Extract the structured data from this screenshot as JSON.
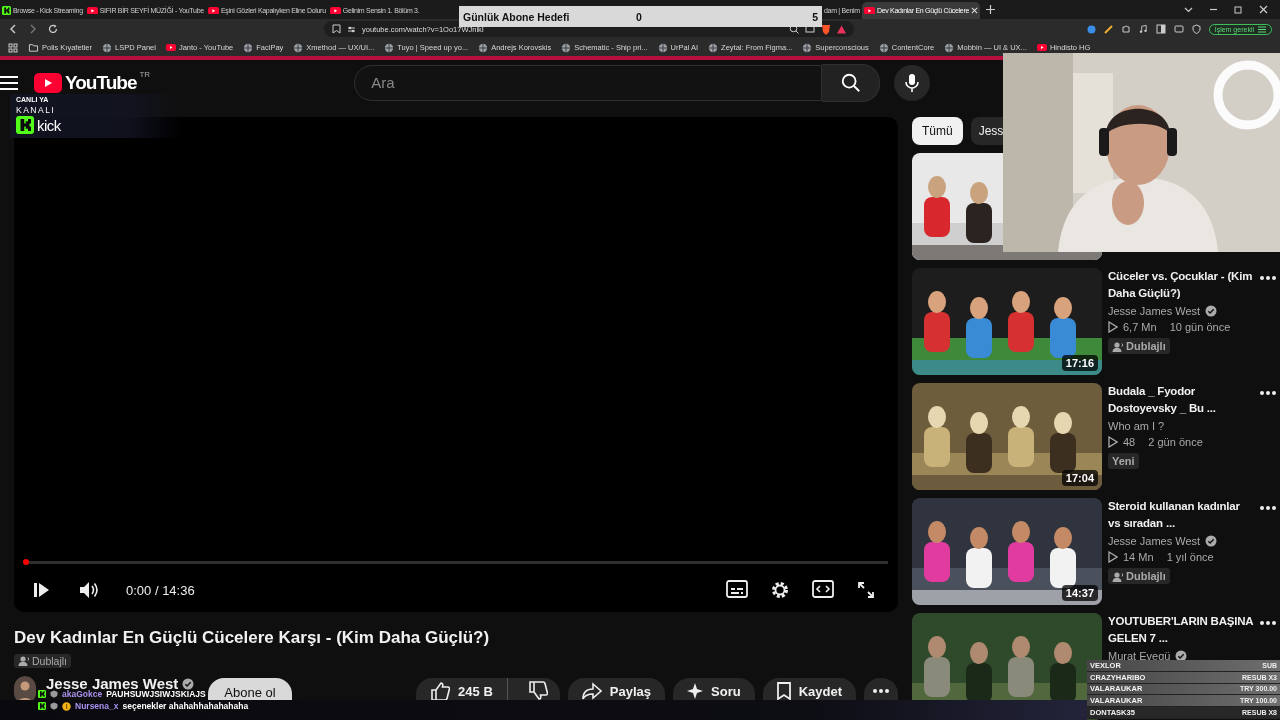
{
  "browser": {
    "tabs": [
      {
        "kind": "kick",
        "title": "Browse - Kick Streaming",
        "selected": false
      },
      {
        "kind": "youtube",
        "title": "SIFIR BİR SEYFİ MÜZİĞİ - YouTube",
        "selected": false
      },
      {
        "kind": "youtube",
        "title": "Eşini Gözleri Kapalıyken Eline Doluru",
        "selected": false
      },
      {
        "kind": "youtube",
        "title": "Gelinim Sensin 1. Bölüm 3.",
        "selected": false
      },
      {
        "kind": "plain",
        "title": "dam | Benim",
        "selected": false
      },
      {
        "kind": "youtube",
        "title": "Dev Kadınlar En Güçlü Cücelere",
        "selected": true
      }
    ],
    "address": "youtube.com/watch?v=1Oo17WJnikI",
    "bookmarks": [
      {
        "kind": "folder",
        "label": "Polis Kıyafetler"
      },
      {
        "kind": "site",
        "label": "LSPD Panel"
      },
      {
        "kind": "youtube",
        "label": "Janto - YouTube"
      },
      {
        "kind": "site",
        "label": "FaciPay"
      },
      {
        "kind": "site",
        "label": "Xmethod — UX/UI..."
      },
      {
        "kind": "site",
        "label": "Tuyo | Speed up yo..."
      },
      {
        "kind": "site",
        "label": "Andrejs Korovskis"
      },
      {
        "kind": "site",
        "label": "Schematic - Ship pri..."
      },
      {
        "kind": "site",
        "label": "UrPal AI"
      },
      {
        "kind": "site",
        "label": "Zeytal: From Figma..."
      },
      {
        "kind": "site",
        "label": "Superconscious"
      },
      {
        "kind": "site",
        "label": "ContentCore"
      },
      {
        "kind": "site",
        "label": "Mobbin — UI & UX..."
      },
      {
        "kind": "youtube",
        "label": "Hindisto HG"
      }
    ],
    "action_button": "İşlem gerekli"
  },
  "youtube": {
    "logo": "YouTube",
    "region": "TR",
    "search": {
      "placeholder": "Ara"
    },
    "player": {
      "time": "0:00 / 14:36",
      "level": 0
    },
    "video": {
      "title": "Dev Kadınlar En Güçlü Cücelere Karşı - (Kim Daha Güçlü?)",
      "badge": "Dublajlı",
      "channel": "Jesse James West",
      "verified": true,
      "subscribe": "Abone ol",
      "likes": "245 B",
      "share": "Paylaş",
      "ask": "Soru",
      "save": "Kaydet"
    },
    "chips": [
      {
        "label": "Tümü",
        "selected": true
      },
      {
        "label": "Jess",
        "selected": false
      }
    ],
    "recommendations": [
      {
        "kind": "picture"
      },
      {
        "title": "Cüceler vs. Çocuklar - (Kim Daha Güçlü?)",
        "channel": "Jesse James West",
        "verified": true,
        "views": "6,7 Mn",
        "age": "10 gün önce",
        "badge": {
          "kind": "dubbed",
          "label": "Dublajlı"
        },
        "duration": "17:16"
      },
      {
        "title": "Budala _ Fyodor Dostoyevsky _ Bu ...",
        "channel": "Who am I ?",
        "verified": false,
        "views": "48",
        "age": "2 gün önce",
        "badge": {
          "kind": "new",
          "label": "Yeni"
        },
        "duration": "17:04"
      },
      {
        "title": "Steroid kullanan kadınlar vs sıradan ...",
        "channel": "Jesse James West",
        "verified": true,
        "views": "14 Mn",
        "age": "1 yıl önce",
        "badge": {
          "kind": "dubbed",
          "label": "Dublajlı"
        },
        "duration": "14:37"
      },
      {
        "title": "YOUTUBER'LARIN BAŞINA GELEN 7 ...",
        "channel": "Murat Evegü",
        "verified": true
      }
    ]
  },
  "overlays": {
    "goal": {
      "title": "Günlük Abone Hedefi",
      "current": "0",
      "target": "5"
    },
    "kick_badge": {
      "line_1": "CANLI YA",
      "line_2": "KANALI",
      "brand": "kick"
    },
    "webcam": {
      "kind": "picture"
    },
    "events": [
      {
        "name": "VEXLOR",
        "detail": "SUB"
      },
      {
        "name": "CRAZYHARIBO",
        "detail": "RESUB X3"
      },
      {
        "name": "VALARAUKAR",
        "detail": "TRY 300.00"
      },
      {
        "name": "VALARAUKAR",
        "detail": "TRY 100.00"
      },
      {
        "name": "DONTASK35",
        "detail": "RESUB X8"
      }
    ],
    "chat": [
      {
        "user": "akaGokce",
        "message": "PAUHSUWJSIWJSKIAJS",
        "coin_badge": false
      },
      {
        "user": "Nursena_x",
        "message": "seçenekler ahahahhahahahaha",
        "coin_badge": true
      }
    ]
  }
}
